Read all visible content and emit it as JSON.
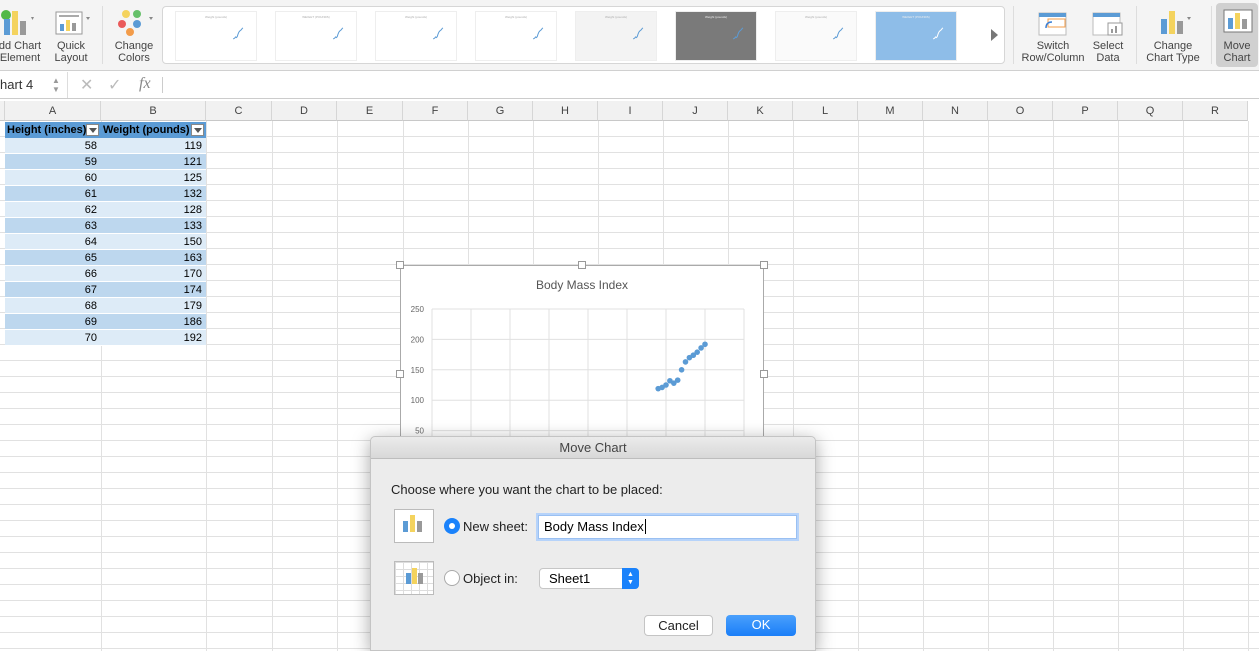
{
  "ribbon": {
    "add_chart_element": "dd Chart\nElement",
    "quick_layout": "Quick\nLayout",
    "change_colors": "Change\nColors",
    "switch_row_column": "Switch\nRow/Column",
    "select_data": "Select\nData",
    "change_chart_type": "Change\nChart Type",
    "move_chart": "Move\nChart",
    "chart_styles": [
      "Weight (pounds)",
      "WEIGHT (POUNDS)",
      "Weight (pounds)",
      "Weight (pounds)",
      "Weight (pounds)",
      "Weight (pounds)",
      "Weight (pounds)",
      "WEIGHT (POUNDS)"
    ]
  },
  "formula_bar": {
    "name_box": "hart 4",
    "fx": "fx",
    "value": ""
  },
  "columns": [
    "A",
    "B",
    "C",
    "D",
    "E",
    "F",
    "G",
    "H",
    "I",
    "J",
    "K",
    "L",
    "M",
    "N",
    "O",
    "P",
    "Q",
    "R"
  ],
  "table": {
    "headers": [
      "Height (inches)",
      "Weight (pounds)"
    ],
    "rows": [
      [
        58,
        119
      ],
      [
        59,
        121
      ],
      [
        60,
        125
      ],
      [
        61,
        132
      ],
      [
        62,
        128
      ],
      [
        63,
        133
      ],
      [
        64,
        150
      ],
      [
        65,
        163
      ],
      [
        66,
        170
      ],
      [
        67,
        174
      ],
      [
        68,
        179
      ],
      [
        69,
        186
      ],
      [
        70,
        192
      ]
    ]
  },
  "chart_data": {
    "type": "scatter",
    "title": "Body Mass Index",
    "x": [
      58,
      59,
      60,
      61,
      62,
      63,
      64,
      65,
      66,
      67,
      68,
      69,
      70
    ],
    "y": [
      119,
      121,
      125,
      132,
      128,
      133,
      150,
      163,
      170,
      174,
      179,
      186,
      192
    ],
    "xlim": [
      0,
      80
    ],
    "ylim": [
      0,
      250
    ],
    "yticks": [
      "250",
      "200",
      "150",
      "100",
      "50"
    ],
    "grid": true,
    "color": "#5b9bd5"
  },
  "dialog": {
    "title": "Move Chart",
    "prompt": "Choose where you want the chart to be placed:",
    "new_sheet_label": "New sheet:",
    "new_sheet_value": "Body Mass Index",
    "object_in_label": "Object in:",
    "object_in_value": "Sheet1",
    "selected": "new_sheet",
    "cancel": "Cancel",
    "ok": "OK",
    "accent": "#1a82fb"
  }
}
